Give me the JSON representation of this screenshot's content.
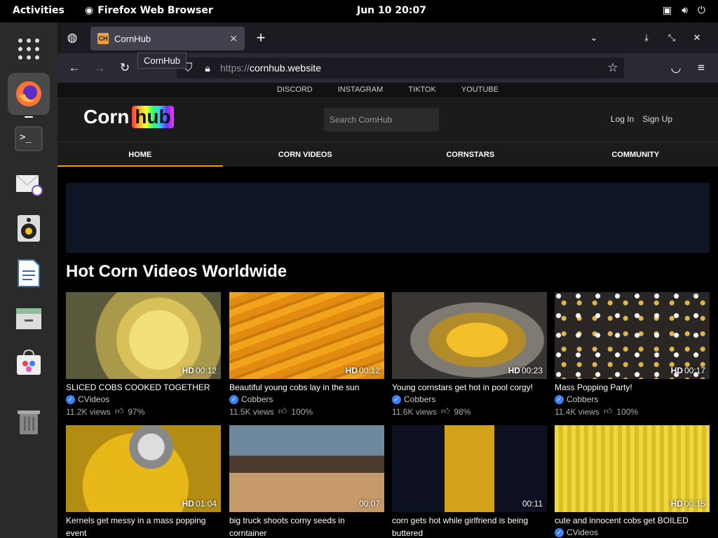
{
  "system": {
    "activities": "Activities",
    "app_name": "Firefox Web Browser",
    "clock": "Jun 10  20:07"
  },
  "browser": {
    "tab_title": "CornHub",
    "tab_favicon": "CH",
    "tooltip": "CornHub",
    "url_scheme": "https://",
    "url_host": "cornhub.website"
  },
  "site": {
    "social_links": [
      "DISCORD",
      "INSTAGRAM",
      "TIKTOK",
      "YOUTUBE"
    ],
    "logo_word1": "Corn",
    "logo_word2": "hub",
    "search_placeholder": "Search CornHub",
    "login": "Log In",
    "signup": "Sign Up",
    "nav": [
      "HOME",
      "CORN VIDEOS",
      "CORNSTARS",
      "COMMUNITY"
    ],
    "section_title": "Hot Corn Videos Worldwide"
  },
  "videos": [
    {
      "title": "SLICED COBS COOKED TOGETHER",
      "channel": "CVideos",
      "views": "11.2K views",
      "rating": "97%",
      "hd": "HD",
      "duration": "00:12"
    },
    {
      "title": "Beautiful young cobs lay in the sun",
      "channel": "Cobbers",
      "views": "11.5K views",
      "rating": "100%",
      "hd": "HD",
      "duration": "00:12"
    },
    {
      "title": "Young cornstars get hot in pool corgy!",
      "channel": "Cobbers",
      "views": "11.6K views",
      "rating": "98%",
      "hd": "HD",
      "duration": "00:23"
    },
    {
      "title": "Mass Popping Party!",
      "channel": "Cobbers",
      "views": "11.4K views",
      "rating": "100%",
      "hd": "HD",
      "duration": "00:17"
    },
    {
      "title": "Kernels get messy in a mass popping event",
      "hd": "HD",
      "duration": "01:04"
    },
    {
      "title": "big truck shoots corny seeds in corntainer",
      "hd": "",
      "duration": "00:07"
    },
    {
      "title": "corn gets hot while girlfriend is being buttered",
      "hd": "",
      "duration": "00:11"
    },
    {
      "title": "cute and innocent cobs get BOILED",
      "channel": "CVideos",
      "hd": "HD",
      "duration": "00:15"
    }
  ]
}
